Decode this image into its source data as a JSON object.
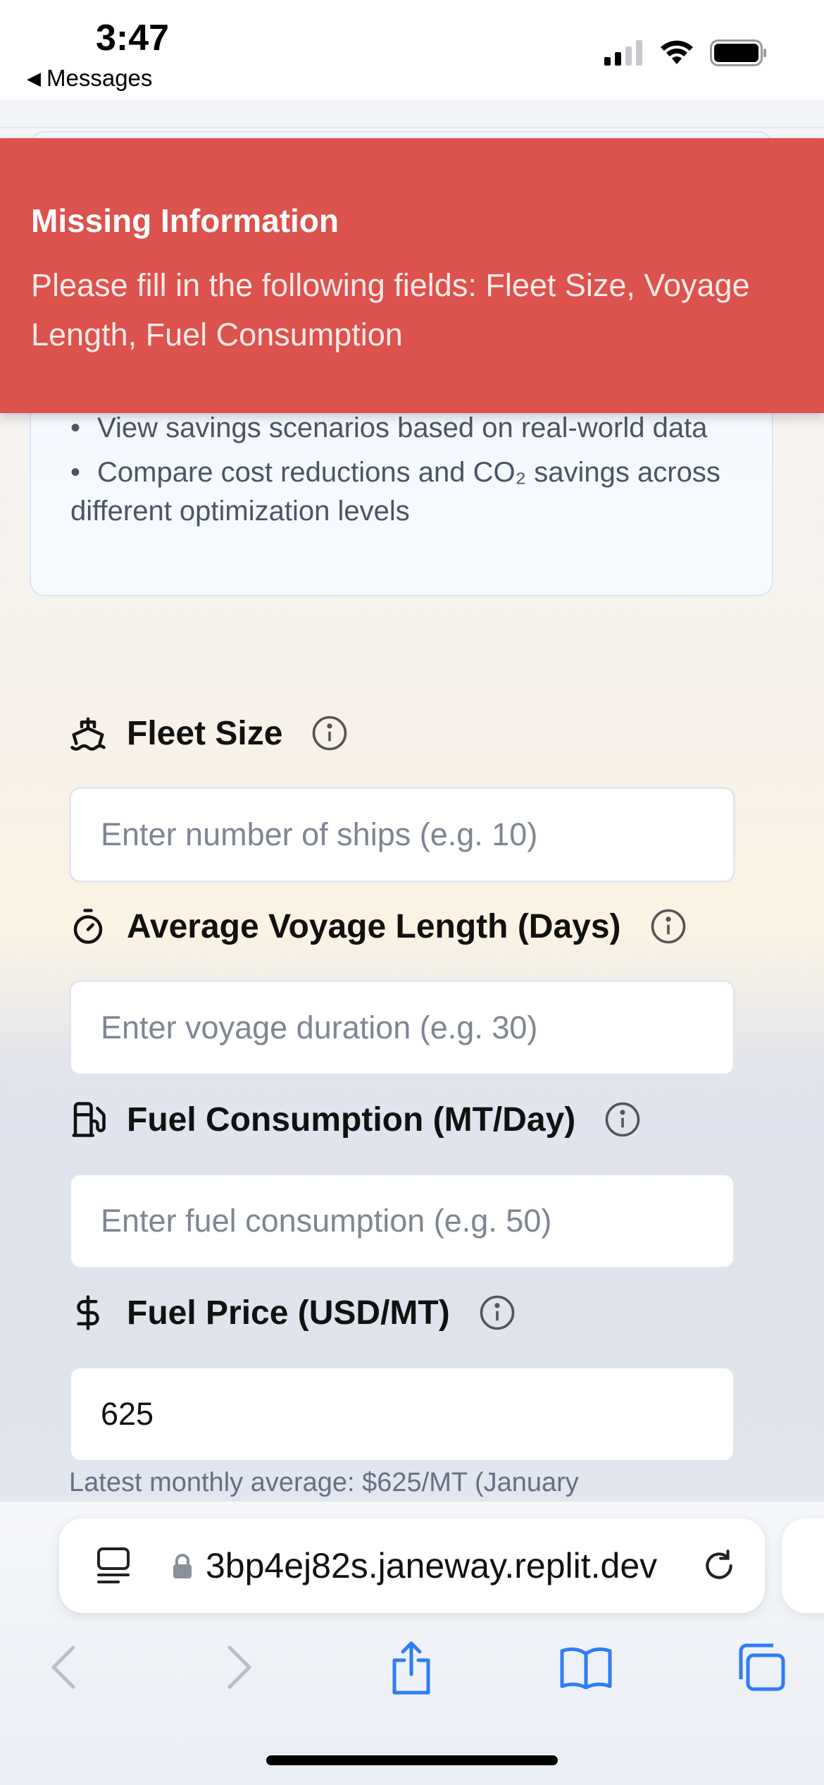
{
  "status_bar": {
    "time": "3:47",
    "back_label": "Messages",
    "icons": [
      "cellular-signal-icon",
      "wifi-icon",
      "battery-icon"
    ]
  },
  "toast": {
    "title": "Missing Information",
    "message": "Please fill in the following fields: Fleet Size, Voyage Length, Fuel Consumption",
    "color": "#dc524c"
  },
  "info_card": {
    "bullets": [
      "View savings scenarios based on real-world data",
      "Compare cost reductions and CO₂ savings across different optimization levels"
    ]
  },
  "form": {
    "fleet_size": {
      "label": "Fleet Size",
      "icon": "ship-icon",
      "placeholder": "Enter number of ships (e.g. 10)",
      "value": ""
    },
    "voyage_length": {
      "label": "Average Voyage Length (Days)",
      "icon": "timer-icon",
      "placeholder": "Enter voyage duration (e.g. 30)",
      "value": ""
    },
    "fuel_consumption": {
      "label": "Fuel Consumption (MT/Day)",
      "icon": "fuel-pump-icon",
      "placeholder": "Enter fuel consumption (e.g. 50)",
      "value": ""
    },
    "fuel_price": {
      "label": "Fuel Price (USD/MT)",
      "icon": "dollar-icon",
      "placeholder": "",
      "value": "625"
    },
    "fuel_price_hint": "Latest monthly average: $625/MT (January"
  },
  "browser": {
    "url": "3bp4ej82s.janeway.replit.dev",
    "accent": "#2f7cf6"
  }
}
